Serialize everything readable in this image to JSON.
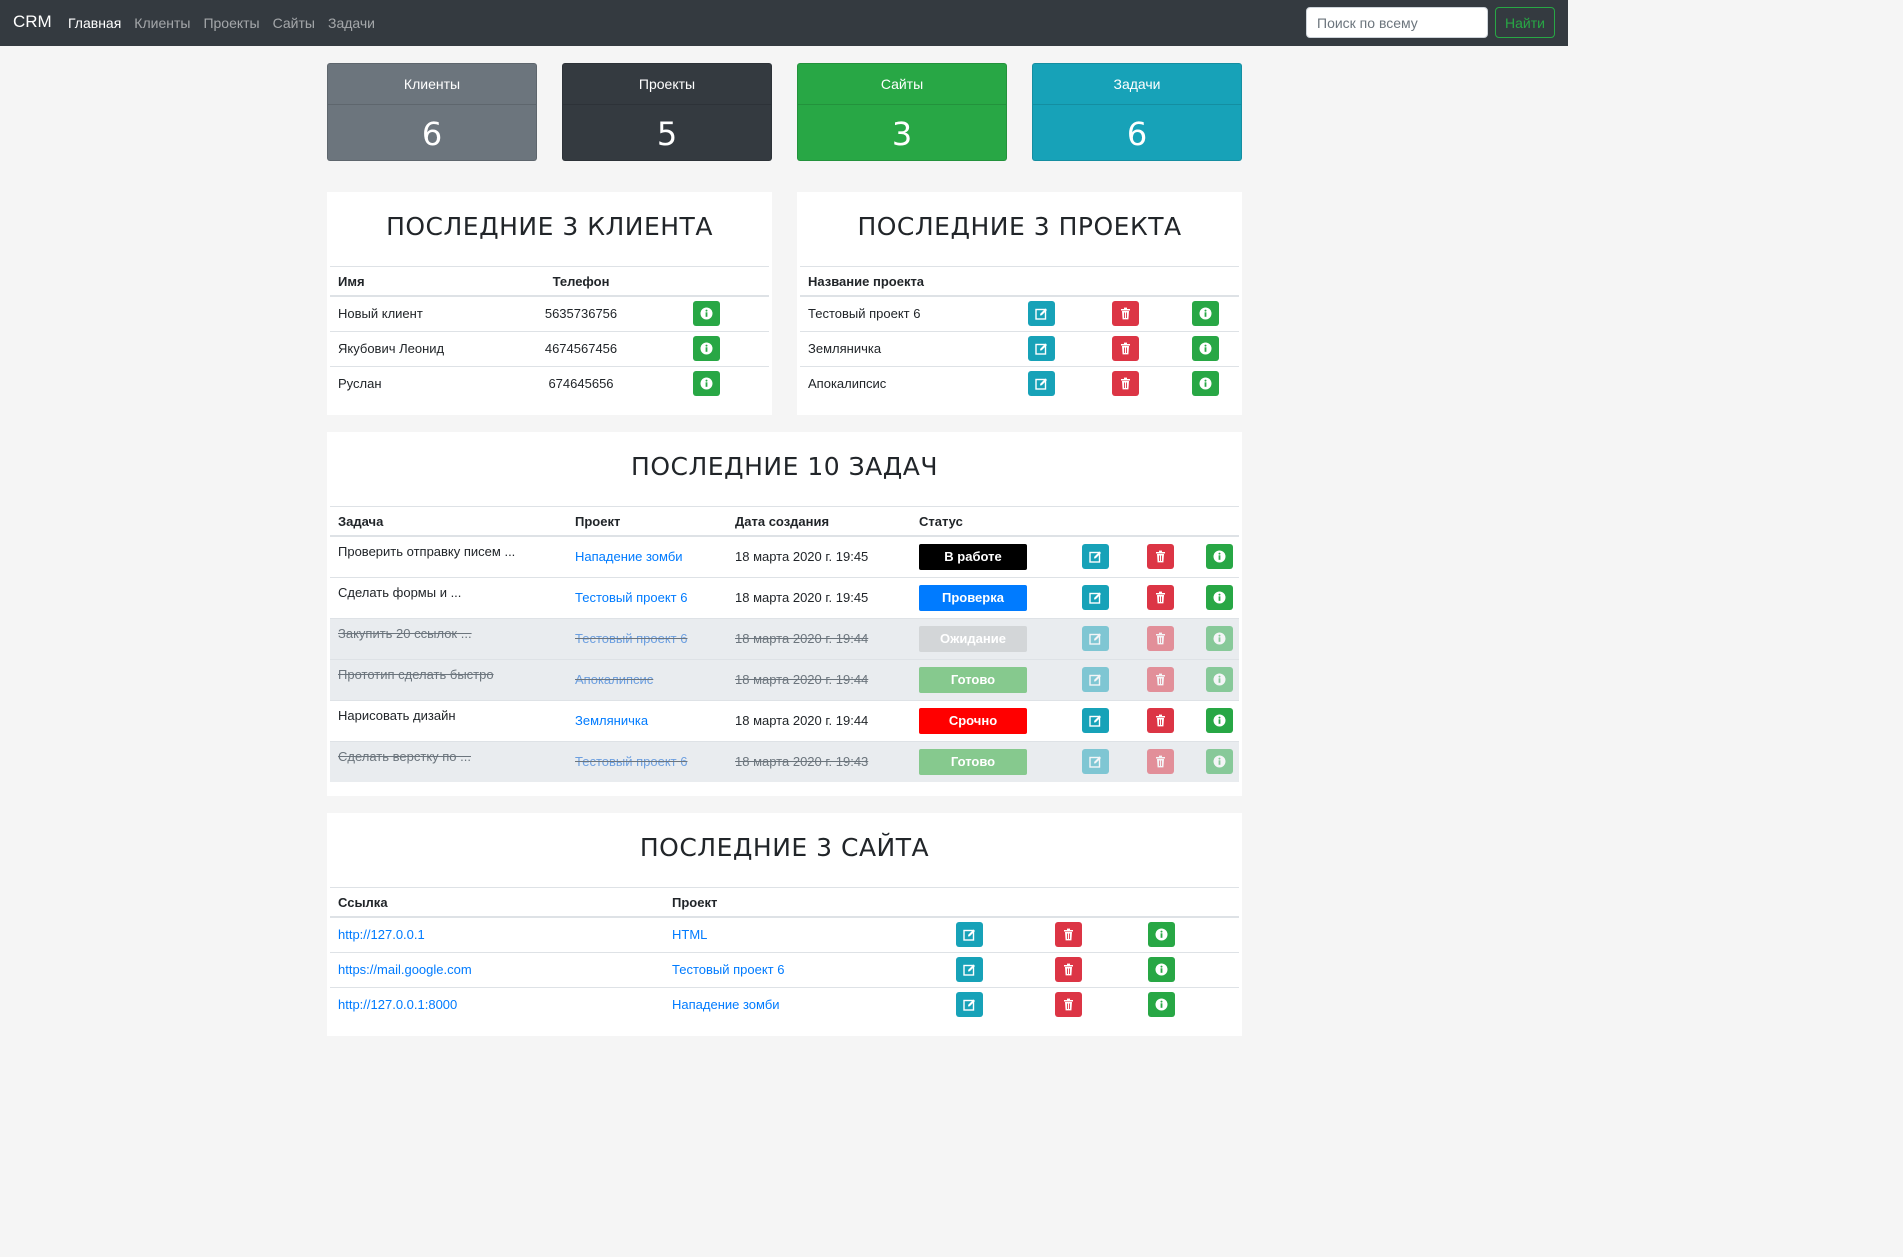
{
  "navbar": {
    "brand": "CRM",
    "items": [
      "Главная",
      "Клиенты",
      "Проекты",
      "Сайты",
      "Задачи"
    ],
    "search_placeholder": "Поиск по всему",
    "search_button": "Найти"
  },
  "stats": [
    {
      "label": "Клиенты",
      "value": "6",
      "color": "#6c757d"
    },
    {
      "label": "Проекты",
      "value": "5",
      "color": "#343a40"
    },
    {
      "label": "Сайты",
      "value": "3",
      "color": "#28a745"
    },
    {
      "label": "Задачи",
      "value": "6",
      "color": "#17a2b8"
    }
  ],
  "clients": {
    "title": "ПОСЛЕДНИЕ 3 КЛИЕНТА",
    "headers": [
      "Имя",
      "Телефон"
    ],
    "rows": [
      {
        "name": "Новый клиент",
        "phone": "5635736756"
      },
      {
        "name": "Якубович Леонид",
        "phone": "4674567456"
      },
      {
        "name": "Руслан",
        "phone": "674645656"
      }
    ]
  },
  "projects": {
    "title": "ПОСЛЕДНИЕ 3 ПРОЕКТА",
    "headers": [
      "Название проекта"
    ],
    "rows": [
      {
        "name": "Тестовый проект 6"
      },
      {
        "name": "Земляничка"
      },
      {
        "name": "Апокалипсис"
      }
    ]
  },
  "tasks": {
    "title": "ПОСЛЕДНИЕ 10 ЗАДАЧ",
    "headers": [
      "Задача",
      "Проект",
      "Дата создания",
      "Статус"
    ],
    "rows": [
      {
        "task": "Проверить отправку писем ...",
        "project": "Нападение зомби",
        "date": "18 марта 2020 г. 19:45",
        "status": "В работе",
        "status_color": "#000000",
        "done": false
      },
      {
        "task": "Сделать формы и ...",
        "project": "Тестовый проект 6",
        "date": "18 марта 2020 г. 19:45",
        "status": "Проверка",
        "status_color": "#007bff",
        "done": false
      },
      {
        "task": "Закупить 20 ссылок ...",
        "project": "Тестовый проект 6",
        "date": "18 марта 2020 г. 19:44",
        "status": "Ожидание",
        "status_color": "#d3d6d8",
        "done": true
      },
      {
        "task": "Прототип сделать быстро",
        "project": "Апокалипсис",
        "date": "18 марта 2020 г. 19:44",
        "status": "Готово",
        "status_color": "#86c98e",
        "done": true
      },
      {
        "task": "Нарисовать дизайн",
        "project": "Земляничка",
        "date": "18 марта 2020 г. 19:44",
        "status": "Срочно",
        "status_color": "#ff0000",
        "done": false
      },
      {
        "task": "Сделать верстку по ...",
        "project": "Тестовый проект 6",
        "date": "18 марта 2020 г. 19:43",
        "status": "Готово",
        "status_color": "#86c98e",
        "done": true
      }
    ]
  },
  "sites": {
    "title": "ПОСЛЕДНИЕ 3 САЙТА",
    "headers": [
      "Ссылка",
      "Проект"
    ],
    "rows": [
      {
        "url": "http://127.0.0.1",
        "project": "HTML"
      },
      {
        "url": "https://mail.google.com",
        "project": "Тестовый проект 6"
      },
      {
        "url": "http://127.0.0.1:8000",
        "project": "Нападение зомби"
      }
    ]
  }
}
